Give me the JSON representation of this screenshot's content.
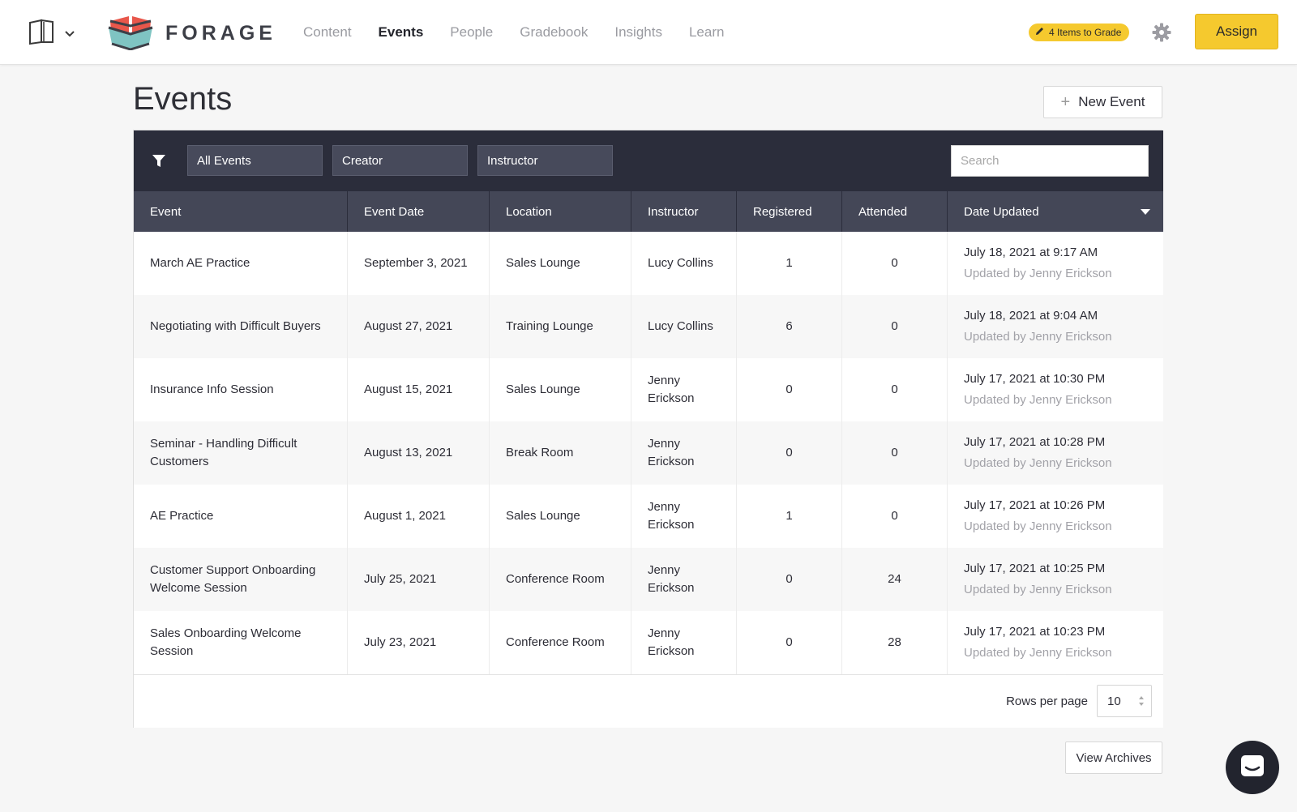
{
  "brand": {
    "name": "FORAGE"
  },
  "nav": [
    {
      "label": "Content",
      "active": false
    },
    {
      "label": "Events",
      "active": true
    },
    {
      "label": "People",
      "active": false
    },
    {
      "label": "Gradebook",
      "active": false
    },
    {
      "label": "Insights",
      "active": false
    },
    {
      "label": "Learn",
      "active": false
    }
  ],
  "header": {
    "grade_badge": "4 Items to Grade",
    "assign_label": "Assign"
  },
  "page": {
    "title": "Events",
    "new_event_label": "New Event",
    "view_archives_label": "View Archives"
  },
  "filters": {
    "events": "All Events",
    "creator": "Creator",
    "instructor": "Instructor",
    "search_placeholder": "Search"
  },
  "table": {
    "columns": [
      "Event",
      "Event Date",
      "Location",
      "Instructor",
      "Registered",
      "Attended",
      "Date Updated"
    ],
    "rows": [
      {
        "event": "March AE Practice",
        "date": "September 3, 2021",
        "location": "Sales Lounge",
        "instructor": "Lucy Collins",
        "registered": "1",
        "attended": "0",
        "updated": "July 18, 2021 at 9:17 AM",
        "updated_by": "Updated by Jenny Erickson"
      },
      {
        "event": "Negotiating with Difficult Buyers",
        "date": "August 27, 2021",
        "location": "Training Lounge",
        "instructor": "Lucy Collins",
        "registered": "6",
        "attended": "0",
        "updated": "July 18, 2021 at 9:04 AM",
        "updated_by": "Updated by Jenny Erickson"
      },
      {
        "event": "Insurance Info Session",
        "date": "August 15, 2021",
        "location": "Sales Lounge",
        "instructor": "Jenny Erickson",
        "registered": "0",
        "attended": "0",
        "updated": "July 17, 2021 at 10:30 PM",
        "updated_by": "Updated by Jenny Erickson"
      },
      {
        "event": "Seminar - Handling Difficult Customers",
        "date": "August 13, 2021",
        "location": "Break Room",
        "instructor": "Jenny Erickson",
        "registered": "0",
        "attended": "0",
        "updated": "July 17, 2021 at 10:28 PM",
        "updated_by": "Updated by Jenny Erickson"
      },
      {
        "event": "AE Practice",
        "date": "August 1, 2021",
        "location": "Sales Lounge",
        "instructor": "Jenny Erickson",
        "registered": "1",
        "attended": "0",
        "updated": "July 17, 2021 at 10:26 PM",
        "updated_by": "Updated by Jenny Erickson"
      },
      {
        "event": "Customer Support Onboarding Welcome Session",
        "date": "July 25, 2021",
        "location": "Conference Room",
        "instructor": "Jenny Erickson",
        "registered": "0",
        "attended": "24",
        "updated": "July 17, 2021 at 10:25 PM",
        "updated_by": "Updated by Jenny Erickson"
      },
      {
        "event": "Sales Onboarding Welcome Session",
        "date": "July 23, 2021",
        "location": "Conference Room",
        "instructor": "Jenny Erickson",
        "registered": "0",
        "attended": "28",
        "updated": "July 17, 2021 at 10:23 PM",
        "updated_by": "Updated by Jenny Erickson"
      }
    ]
  },
  "pagination": {
    "rows_per_page_label": "Rows per page",
    "rows_per_page": "10"
  },
  "colors": {
    "accent": "#f5c92e",
    "filterbar": "#2b2d3b",
    "table_header": "#444757"
  },
  "icons": [
    "book-icon",
    "chevron-down-icon",
    "forage-logo-icon",
    "pencil-icon",
    "gear-icon",
    "filter-icon",
    "sort-down-icon",
    "chat-icon"
  ]
}
